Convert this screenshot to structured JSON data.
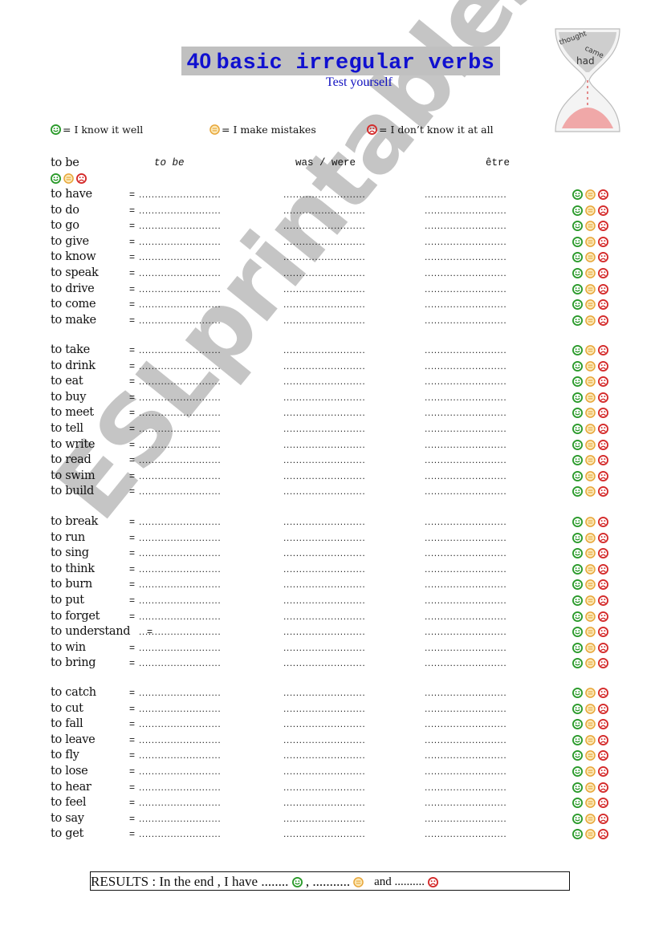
{
  "header": {
    "title_number": "40",
    "title_text": "basic irregular verbs",
    "subtitle": "Test yourself",
    "image": "hourglass-words-image"
  },
  "legend": [
    {
      "icon": "smiley-happy-icon",
      "color": "#2a9a2a",
      "label": "= I know it well"
    },
    {
      "icon": "smiley-neutral-icon",
      "color": "#e8a63a",
      "label": "= I make mistakes"
    },
    {
      "icon": "smiley-sad-icon",
      "color": "#d42a2a",
      "label": "= I don’t know it at all"
    }
  ],
  "colors": {
    "title_text": "#1010d0",
    "title_background": "#c0c0c0",
    "happy": "#2a9a2a",
    "neutral": "#e8a63a",
    "sad": "#d42a2a",
    "watermark": "#969696"
  },
  "example": {
    "verb": "to be",
    "infinitive": "to be",
    "past": "was / were",
    "translation": "être"
  },
  "blank": "= ........................",
  "blank_dots": "..........................",
  "groups": [
    {
      "verbs": [
        "to have",
        "to do",
        "to go",
        "to give",
        "to know",
        "to speak",
        "to drive",
        "to come",
        "to make"
      ]
    },
    {
      "verbs": [
        "to take",
        "to drink",
        "to eat",
        "to buy",
        "to meet",
        "to tell",
        "to write",
        "to read",
        "to swim",
        "to build"
      ]
    },
    {
      "verbs": [
        "to break",
        "to run",
        "to sing",
        "to think",
        "to burn",
        "to put",
        "to forget",
        "to understand",
        "to win",
        "to bring"
      ]
    },
    {
      "verbs": [
        "to catch",
        "to cut",
        "to fall",
        "to leave",
        "to fly",
        "to lose",
        "to hear",
        "to feel",
        "to say",
        "to get"
      ]
    }
  ],
  "results": {
    "prefix": "RESULTS : In the end , I have ........",
    "sep1": ",  ...........",
    "and": "and ..........",
    "trail": ""
  },
  "watermark": "ESLprintables.com"
}
